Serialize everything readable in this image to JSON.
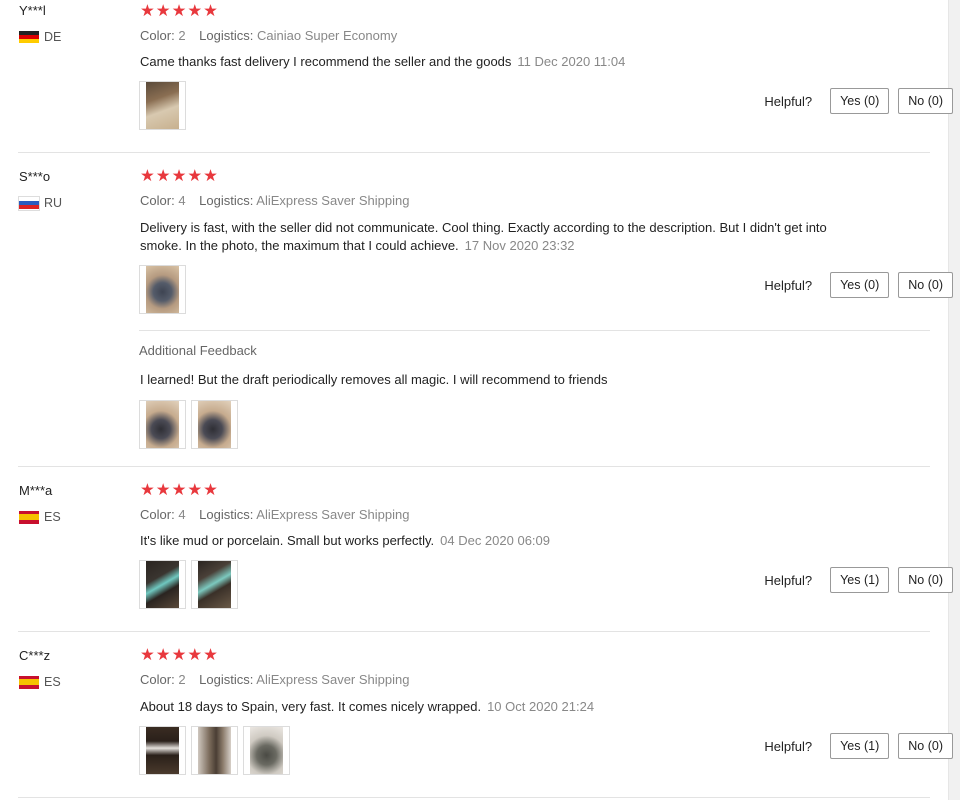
{
  "colors": {
    "star": "#e8383d",
    "accent_text": "#888888"
  },
  "labels": {
    "color": "Color:",
    "logistics": "Logistics:",
    "helpful": "Helpful?",
    "additional_feedback": "Additional Feedback"
  },
  "reviews": [
    {
      "user": "Y***l",
      "country": "DE",
      "stars": "★★★★★",
      "color_value": "2",
      "logistics_value": "Cainiao Super Economy",
      "text": "Came thanks fast delivery I recommend the seller and the goods",
      "date": "11 Dec 2020 11:04",
      "photo_icons": [
        "review-photo-icon"
      ],
      "yes": "Yes (0)",
      "no": "No (0)"
    },
    {
      "user": "S***o",
      "country": "RU",
      "stars": "★★★★★",
      "color_value": "4",
      "logistics_value": "AliExpress Saver Shipping",
      "text": "Delivery is fast, with the seller did not communicate. Cool thing. Exactly according to the description. But I didn't get into smoke. In the photo, the maximum that I could achieve.",
      "date": "17 Nov 2020 23:32",
      "yes": "Yes (0)",
      "no": "No (0)",
      "additional": {
        "text": "I learned! But the draft periodically removes all magic. I will recommend to friends"
      }
    },
    {
      "user": "M***a",
      "country": "ES",
      "stars": "★★★★★",
      "color_value": "4",
      "logistics_value": "AliExpress Saver Shipping",
      "text": "It's like mud or porcelain. Small but works perfectly.",
      "date": "04 Dec 2020 06:09",
      "yes": "Yes (1)",
      "no": "No (0)"
    },
    {
      "user": "C***z",
      "country": "ES",
      "stars": "★★★★★",
      "color_value": "2",
      "logistics_value": "AliExpress Saver Shipping",
      "text": "About 18 days to Spain, very fast. It comes nicely wrapped.",
      "date": "10 Oct 2020 21:24",
      "yes": "Yes (1)",
      "no": "No (0)"
    }
  ]
}
